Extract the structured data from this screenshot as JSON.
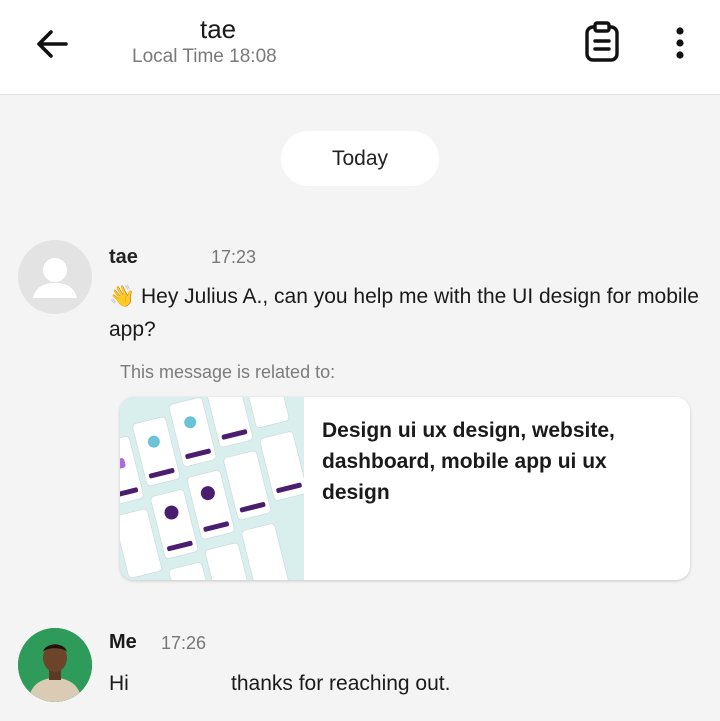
{
  "header": {
    "back_icon": "arrow-left-icon",
    "contact_name": "tae",
    "local_time": "Local Time 18:08",
    "clipboard_icon": "clipboard-icon",
    "more_icon": "more-vertical-icon"
  },
  "chat": {
    "date_divider": "Today",
    "messages": [
      {
        "sender": "tae",
        "time": "17:23",
        "text": "👋 Hey Julius A., can you help me with the UI design for mobile app?",
        "related_label": "This message is related to:",
        "related_gig_title": "Design ui ux design, website, dashboard, mobile app ui ux design"
      },
      {
        "sender": "Me",
        "time": "17:26",
        "text_before": "Hi",
        "text_after": "thanks for reaching out."
      }
    ]
  },
  "colors": {
    "background": "#f4f4f4",
    "header_bg": "#ffffff",
    "accent_purple": "#4a1d6e",
    "muted_text": "#7a7a7a",
    "thumb_bg": "#d8efee"
  }
}
